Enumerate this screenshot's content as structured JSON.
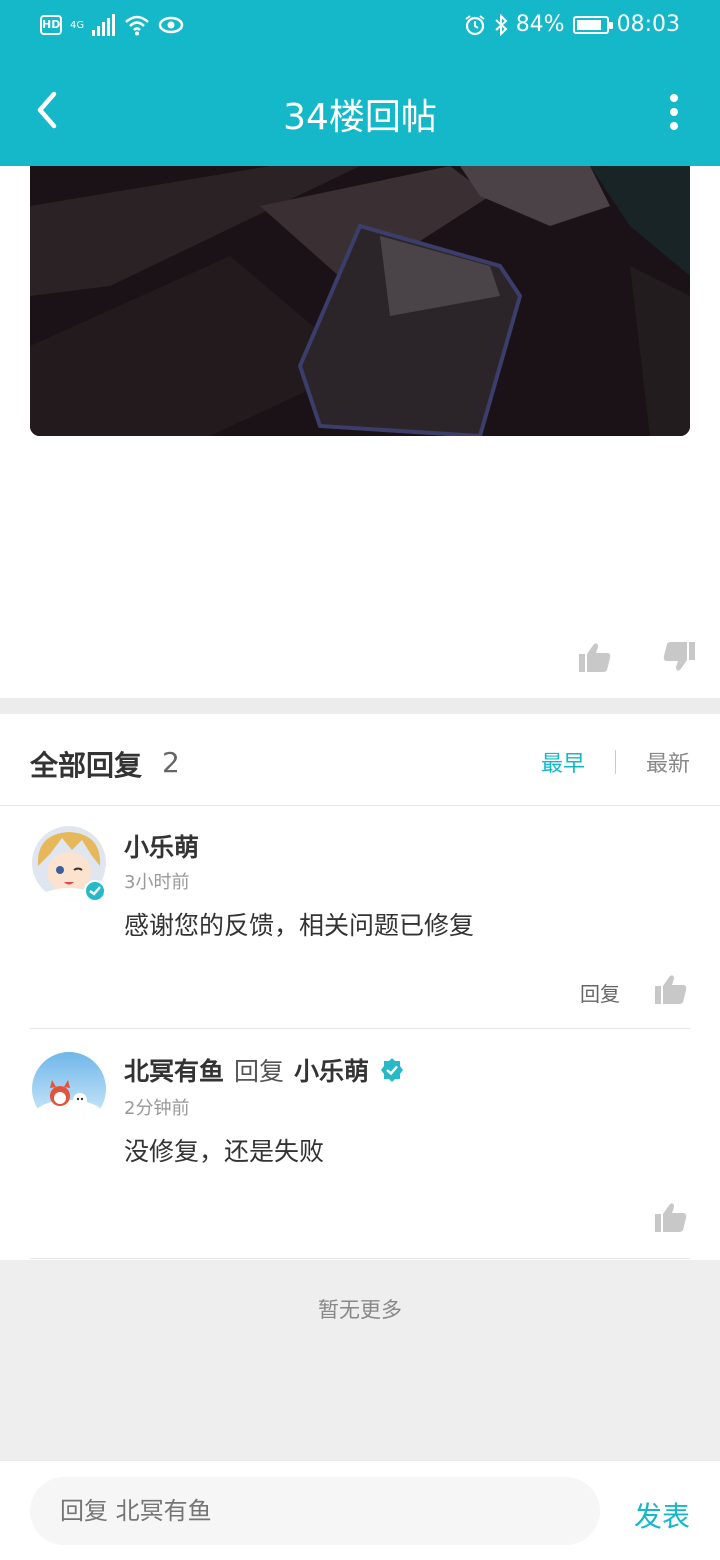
{
  "status_bar": {
    "hd": "HD",
    "network": "4G",
    "battery": "84%",
    "battery_level": 0.84,
    "time": "08:03"
  },
  "header": {
    "title": "34楼回帖"
  },
  "replies_header": {
    "title": "全部回复",
    "count": "2",
    "sort_earliest": "最早",
    "sort_latest": "最新"
  },
  "replies": [
    {
      "username": "小乐萌",
      "time": "3小时前",
      "content": "感谢您的反馈，相关问题已修复",
      "reply_label": "回复"
    },
    {
      "username": "北冥有鱼",
      "reply_word": "回复",
      "reply_to": "小乐萌",
      "time": "2分钟前",
      "content": "没修复，还是失败"
    }
  ],
  "no_more": "暂无更多",
  "composer": {
    "placeholder": "回复 北冥有鱼",
    "send_label": "发表"
  },
  "colors": {
    "accent": "#14b8c8",
    "divider": "#ececec"
  }
}
